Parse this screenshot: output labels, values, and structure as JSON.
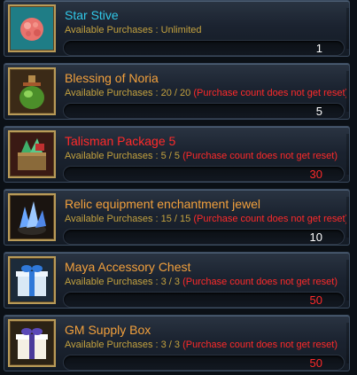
{
  "items": [
    {
      "name": "Star Stive",
      "name_color": "cyan",
      "purchases": "Available Purchases : Unlimited",
      "note": "",
      "qty": "1",
      "qty_color": "white",
      "icon": "star-stive-icon"
    },
    {
      "name": "Blessing of Noria",
      "name_color": "orange",
      "purchases": "Available Purchases : 20 / 20",
      "note": "(Purchase count does not get reset)",
      "qty": "5",
      "qty_color": "white",
      "icon": "potion-icon"
    },
    {
      "name": "Talisman Package 5",
      "name_color": "red",
      "purchases": "Available Purchases : 5 / 5",
      "note": "(Purchase count does not get reset)",
      "qty": "30",
      "qty_color": "red",
      "icon": "talisman-chest-icon"
    },
    {
      "name": "Relic equipment enchantment jewel",
      "name_color": "orange",
      "purchases": "Available Purchases : 15 / 15",
      "note": "(Purchase count does not get reset)",
      "qty": "10",
      "qty_color": "white",
      "icon": "jewel-icon"
    },
    {
      "name": "Maya Accessory Chest",
      "name_color": "orange",
      "purchases": "Available Purchases : 3 / 3",
      "note": "(Purchase count does not get reset)",
      "qty": "50",
      "qty_color": "red",
      "icon": "gift-box-blue-icon"
    },
    {
      "name": "GM Supply Box",
      "name_color": "orange",
      "purchases": "Available Purchases : 3 / 3",
      "note": "(Purchase count does not get reset)",
      "qty": "50",
      "qty_color": "red",
      "icon": "gift-box-white-icon"
    }
  ],
  "colors": {
    "cyan": "#31c8e8",
    "orange": "#f2a03c",
    "red": "#ff2a2a",
    "gold": "#c4a23f",
    "white": "#ffffff"
  }
}
